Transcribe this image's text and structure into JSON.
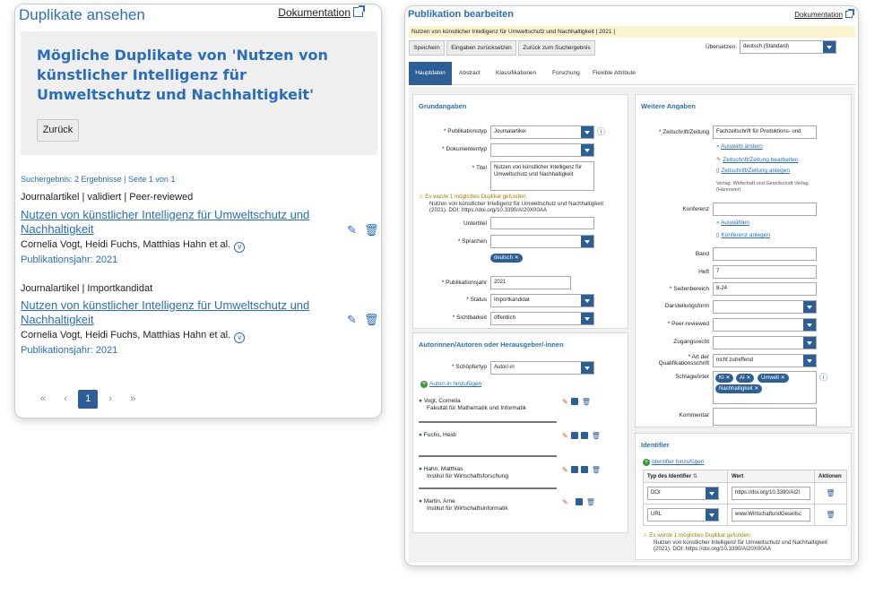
{
  "left": {
    "title": "Duplikate ansehen",
    "doc_link": "Dokumentation",
    "heading": "Mögliche Duplikate von 'Nutzen von künstlicher Intelligenz für Umweltschutz und Nachhaltigkeit'",
    "back_button": "Zurück",
    "result_info": "Suchergebnis: 2 Ergebnisse | Seite 1 von 1",
    "entries": [
      {
        "meta": "Journalartikel | validiert | Peer-reviewed",
        "title": "Nutzen von künstlicher Intelligenz für Umweltschutz und Nachhaltigkeit",
        "authors": "Cornelia Vogt, Heidi Fuchs, Matthias Hahn et al.",
        "year": "Publikationsjahr: 2021"
      },
      {
        "meta": "Journalartikel | Importkandidat",
        "title": "Nutzen von künstlicher Intelligenz für Umweltschutz und Nachhaltigkeit",
        "authors": "Cornelia Vogt, Heidi Fuchs, Matthias Hahn et al.",
        "year": "Publikationsjahr: 2021"
      }
    ],
    "pager": {
      "first": "«",
      "prev": "‹",
      "current": "1",
      "next": "›",
      "last": "»"
    }
  },
  "right": {
    "title": "Publikation bearbeiten",
    "doc_link": "Dokumentation",
    "subtitle": "Nutzen von künstlicher Intelligenz für Umweltschutz und Nachhaltigkeit | 2021 |",
    "toolbar": {
      "save": "Speichern",
      "reset": "Eingaben zurücksetzen",
      "back": "Zurück zum Suchergebnis"
    },
    "translation_label": "Übersetzen:",
    "translation_value": "deutsch (Standard)",
    "tabs": [
      "Hauptdaten",
      "Abstract",
      "Klassifikationen",
      "Forschung",
      "Flexible Attribute"
    ],
    "grund": {
      "heading": "Grundangaben",
      "publikationstyp_label": "* Publikationstyp",
      "publikationstyp_value": "Journalartikel",
      "dokumententyp_label": "* Dokumententyp",
      "titel_label": "* Titel",
      "titel_value": "Nutzen von künstlicher Intelligenz für Umweltschutz und Nachhaltigkeit",
      "warn_head": "Es wurde 1 mögliches Duplikat gefunden:",
      "warn_body": "Nutzen von künstlicher Intelligenz für Umweltschutz und Nachhaltigkeit (2021). DOI: https://doi.org/10.3390/AI20X00AA",
      "untertitel_label": "Untertitel",
      "sprachen_label": "* Sprachen",
      "sprache_chip": "deutsch",
      "jahr_label": "* Publikationsjahr",
      "jahr_value": "2021",
      "status_label": "* Status",
      "status_value": "Importkandidat",
      "sicht_label": "* Sichtbarkeit",
      "sicht_value": "öffentlich"
    },
    "autoren": {
      "heading": "Autorinnen/Autoren oder Herausgeber/-innen",
      "schoepfer_label": "* Schöpfertyp",
      "schoepfer_value": "Autor/-in",
      "add": "Autor/-in hinzufügen",
      "people": [
        {
          "name": "Vogt, Cornelia",
          "org": "Fakultät für Mathematik und Informatik"
        },
        {
          "name": "Fuchs, Heidi",
          "org": ""
        },
        {
          "name": "Hahn, Matthias",
          "org": "Institut für Wirtschaftsforschung"
        },
        {
          "name": "Martin, Arne",
          "org": "Institut für Wirtschaftsinformatik"
        }
      ]
    },
    "weitere": {
      "heading": "Weitere Angaben",
      "zeitschrift_label": "* Zeitschrift/Zeitung",
      "zeitschrift_value": "Fachzeitschrift für Produktions- und",
      "auswahl": "Auswahl ändern",
      "bearbeiten": "Zeitschrift/Zeitung bearbeiten",
      "anlegen": "Zeitschrift/Zeitung anlegen",
      "verlag": "Verlag: Wirtschaft und Gesellschaft Verlag (Hannover)",
      "konferenz_label": "Konferenz",
      "konf_auswaehlen": "Auswählen",
      "konf_anlegen": "Konferenz anlegen",
      "band_label": "Band",
      "heft_label": "Heft",
      "heft_value": "7",
      "seiten_label": "* Seitenbereich",
      "seiten_value": "8-24",
      "darstellung_label": "Darstellungsform",
      "peer_label": "* Peer-reviewed",
      "zugang_label": "Zugangsrecht",
      "art_label": "* Art der Qualifikationsschrift",
      "art_value": "nicht zutreffend",
      "schlag_label": "Schlagwörter",
      "schlag_chips": [
        "KI",
        "AI",
        "Umwelt",
        "Nachhaltigkeit"
      ],
      "kommentar_label": "Kommentar"
    },
    "identifier": {
      "heading": "Identifier",
      "add": "Identifier hinzufügen",
      "col_type": "Typ des Identifier",
      "col_value": "Wert",
      "col_actions": "Aktionen",
      "rows": [
        {
          "type": "DOI",
          "value": "https://doi.org/10.3390/AI2I"
        },
        {
          "type": "URL",
          "value": "www.WirtschaftundGesellsc"
        }
      ],
      "warn_head": "Es wurde 1 mögliches Duplikat gefunden:",
      "warn_body": "Nutzen von künstlicher Intelligenz für Umweltschutz und Nachhaltigkeit (2021). DOI: https://doi.org/10.3390/AI20X00AA"
    }
  }
}
